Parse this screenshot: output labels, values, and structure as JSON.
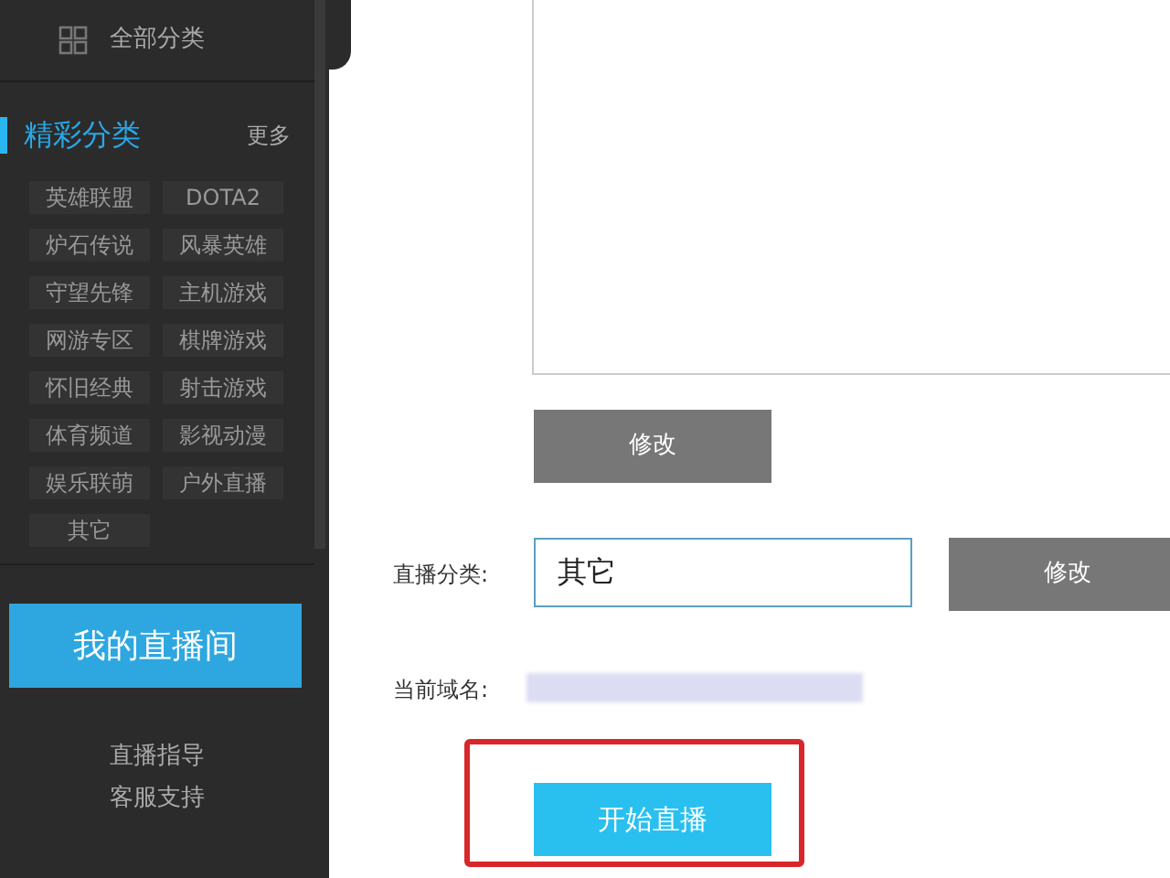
{
  "sidebar": {
    "all_categories": "全部分类",
    "section_title": "精彩分类",
    "more_link": "更多",
    "tags": [
      {
        "label": "英雄联盟"
      },
      {
        "label": "DOTA2"
      },
      {
        "label": "炉石传说"
      },
      {
        "label": "风暴英雄"
      },
      {
        "label": "守望先锋"
      },
      {
        "label": "主机游戏"
      },
      {
        "label": "网游专区"
      },
      {
        "label": "棋牌游戏"
      },
      {
        "label": "怀旧经典"
      },
      {
        "label": "射击游戏"
      },
      {
        "label": "体育频道"
      },
      {
        "label": "影视动漫"
      },
      {
        "label": "娱乐联萌"
      },
      {
        "label": "户外直播"
      },
      {
        "label": "其它"
      }
    ],
    "my_room_button": "我的直播间",
    "links": [
      "直播指导",
      "客服支持"
    ]
  },
  "form": {
    "description_edit_button": "修改",
    "category": {
      "label": "直播分类:",
      "value": "其它",
      "button": "修改"
    },
    "domain": {
      "label": "当前域名:"
    },
    "start_button": "开始直播"
  }
}
